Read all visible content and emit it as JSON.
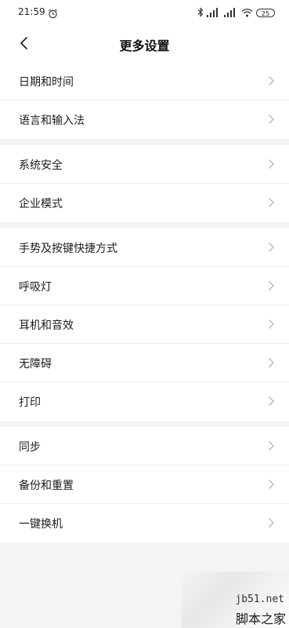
{
  "status_bar": {
    "time": "21:59",
    "battery": "25"
  },
  "header": {
    "title": "更多设置"
  },
  "groups": [
    {
      "items": [
        {
          "label": "日期和时间"
        },
        {
          "label": "语言和输入法"
        }
      ]
    },
    {
      "items": [
        {
          "label": "系统安全"
        },
        {
          "label": "企业模式"
        }
      ]
    },
    {
      "items": [
        {
          "label": "手势及按键快捷方式"
        },
        {
          "label": "呼吸灯"
        },
        {
          "label": "耳机和音效"
        },
        {
          "label": "无障碍"
        },
        {
          "label": "打印"
        }
      ]
    },
    {
      "items": [
        {
          "label": "同步"
        },
        {
          "label": "备份和重置"
        },
        {
          "label": "一键换机"
        }
      ]
    }
  ],
  "watermark": {
    "domain": "jb51.net",
    "name": "脚本之家"
  },
  "icons": {
    "back": "back-arrow-icon",
    "chevron": "chevron-right-icon",
    "alarm": "alarm-icon",
    "bluetooth": "bluetooth-icon",
    "wifi": "wifi-icon"
  }
}
